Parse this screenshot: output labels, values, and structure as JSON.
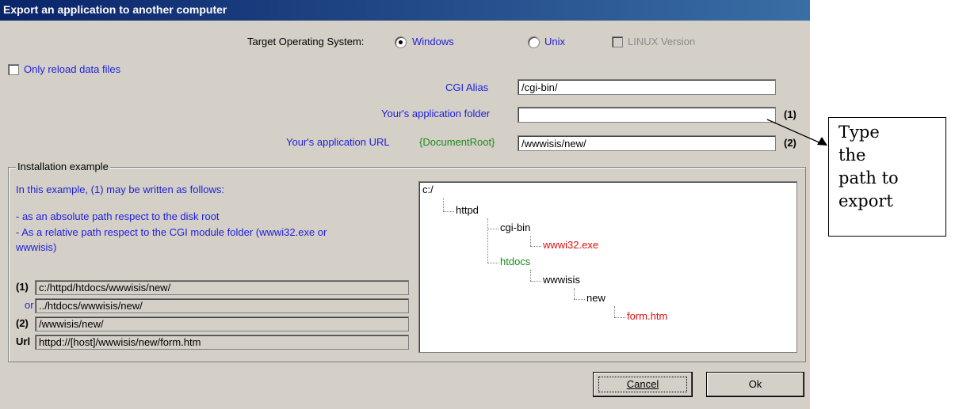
{
  "window": {
    "title": "Export an application to another computer"
  },
  "target_os": {
    "label": "Target Operating System:",
    "options": [
      {
        "label": "Windows",
        "selected": true
      },
      {
        "label": "Unix",
        "selected": false
      }
    ],
    "linux_checkbox": {
      "label": "LINUX Version",
      "checked": false,
      "enabled": false
    }
  },
  "only_reload": {
    "label": "Only reload data files",
    "checked": false
  },
  "fields": {
    "cgi_alias": {
      "label": "CGI Alias",
      "value": "/cgi-bin/"
    },
    "app_folder": {
      "label": "Your's application folder",
      "value": "",
      "marker": "(1)"
    },
    "app_url": {
      "label": "Your's application URL",
      "hint": "{DocumentRoot}",
      "value": "/wwwisis/new/",
      "marker": "(2)"
    }
  },
  "install_example": {
    "title": "Installation example",
    "intro": "In this example, (1) may be written as follows:",
    "bullets": [
      "- as an absolute path respect to the disk root",
      "- As a relative path respect to the CGI module folder (wwwi32.exe or",
      "wwwisis)"
    ],
    "rows": [
      {
        "label": "(1)",
        "value": "c:/httpd/htdocs/wwwisis/new/"
      },
      {
        "label": "or",
        "value": "../htdocs/wwwisis/new/"
      },
      {
        "label": "(2)",
        "value": "/wwwisis/new/"
      },
      {
        "label": "Url",
        "value": "httpd://[host]/wwwisis/new/form.htm"
      }
    ],
    "tree": [
      "c:/",
      "httpd",
      "cgi-bin",
      "wwwi32.exe",
      "htdocs",
      "wwwisis",
      "new",
      "form.htm"
    ]
  },
  "buttons": {
    "cancel": "Cancel",
    "ok": "Ok"
  },
  "callout": {
    "line1": "Type",
    "line2": "the",
    "line3": "path to",
    "line4": "export"
  },
  "colors": {
    "title_bar": "#0a246a",
    "label_blue": "#1e1edc",
    "green": "#1d8a1d",
    "red": "#e01010",
    "dialog_bg": "#d4d0c8"
  }
}
